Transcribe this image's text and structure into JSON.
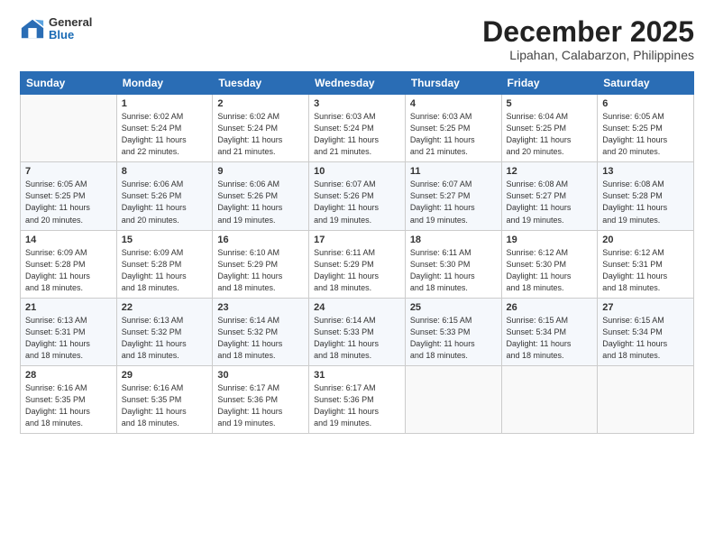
{
  "header": {
    "logo": {
      "general": "General",
      "blue": "Blue"
    },
    "title": "December 2025",
    "location": "Lipahan, Calabarzon, Philippines"
  },
  "calendar": {
    "days_of_week": [
      "Sunday",
      "Monday",
      "Tuesday",
      "Wednesday",
      "Thursday",
      "Friday",
      "Saturday"
    ],
    "weeks": [
      [
        {
          "num": "",
          "info": ""
        },
        {
          "num": "1",
          "info": "Sunrise: 6:02 AM\nSunset: 5:24 PM\nDaylight: 11 hours\nand 22 minutes."
        },
        {
          "num": "2",
          "info": "Sunrise: 6:02 AM\nSunset: 5:24 PM\nDaylight: 11 hours\nand 21 minutes."
        },
        {
          "num": "3",
          "info": "Sunrise: 6:03 AM\nSunset: 5:24 PM\nDaylight: 11 hours\nand 21 minutes."
        },
        {
          "num": "4",
          "info": "Sunrise: 6:03 AM\nSunset: 5:25 PM\nDaylight: 11 hours\nand 21 minutes."
        },
        {
          "num": "5",
          "info": "Sunrise: 6:04 AM\nSunset: 5:25 PM\nDaylight: 11 hours\nand 20 minutes."
        },
        {
          "num": "6",
          "info": "Sunrise: 6:05 AM\nSunset: 5:25 PM\nDaylight: 11 hours\nand 20 minutes."
        }
      ],
      [
        {
          "num": "7",
          "info": "Sunrise: 6:05 AM\nSunset: 5:25 PM\nDaylight: 11 hours\nand 20 minutes."
        },
        {
          "num": "8",
          "info": "Sunrise: 6:06 AM\nSunset: 5:26 PM\nDaylight: 11 hours\nand 20 minutes."
        },
        {
          "num": "9",
          "info": "Sunrise: 6:06 AM\nSunset: 5:26 PM\nDaylight: 11 hours\nand 19 minutes."
        },
        {
          "num": "10",
          "info": "Sunrise: 6:07 AM\nSunset: 5:26 PM\nDaylight: 11 hours\nand 19 minutes."
        },
        {
          "num": "11",
          "info": "Sunrise: 6:07 AM\nSunset: 5:27 PM\nDaylight: 11 hours\nand 19 minutes."
        },
        {
          "num": "12",
          "info": "Sunrise: 6:08 AM\nSunset: 5:27 PM\nDaylight: 11 hours\nand 19 minutes."
        },
        {
          "num": "13",
          "info": "Sunrise: 6:08 AM\nSunset: 5:28 PM\nDaylight: 11 hours\nand 19 minutes."
        }
      ],
      [
        {
          "num": "14",
          "info": "Sunrise: 6:09 AM\nSunset: 5:28 PM\nDaylight: 11 hours\nand 18 minutes."
        },
        {
          "num": "15",
          "info": "Sunrise: 6:09 AM\nSunset: 5:28 PM\nDaylight: 11 hours\nand 18 minutes."
        },
        {
          "num": "16",
          "info": "Sunrise: 6:10 AM\nSunset: 5:29 PM\nDaylight: 11 hours\nand 18 minutes."
        },
        {
          "num": "17",
          "info": "Sunrise: 6:11 AM\nSunset: 5:29 PM\nDaylight: 11 hours\nand 18 minutes."
        },
        {
          "num": "18",
          "info": "Sunrise: 6:11 AM\nSunset: 5:30 PM\nDaylight: 11 hours\nand 18 minutes."
        },
        {
          "num": "19",
          "info": "Sunrise: 6:12 AM\nSunset: 5:30 PM\nDaylight: 11 hours\nand 18 minutes."
        },
        {
          "num": "20",
          "info": "Sunrise: 6:12 AM\nSunset: 5:31 PM\nDaylight: 11 hours\nand 18 minutes."
        }
      ],
      [
        {
          "num": "21",
          "info": "Sunrise: 6:13 AM\nSunset: 5:31 PM\nDaylight: 11 hours\nand 18 minutes."
        },
        {
          "num": "22",
          "info": "Sunrise: 6:13 AM\nSunset: 5:32 PM\nDaylight: 11 hours\nand 18 minutes."
        },
        {
          "num": "23",
          "info": "Sunrise: 6:14 AM\nSunset: 5:32 PM\nDaylight: 11 hours\nand 18 minutes."
        },
        {
          "num": "24",
          "info": "Sunrise: 6:14 AM\nSunset: 5:33 PM\nDaylight: 11 hours\nand 18 minutes."
        },
        {
          "num": "25",
          "info": "Sunrise: 6:15 AM\nSunset: 5:33 PM\nDaylight: 11 hours\nand 18 minutes."
        },
        {
          "num": "26",
          "info": "Sunrise: 6:15 AM\nSunset: 5:34 PM\nDaylight: 11 hours\nand 18 minutes."
        },
        {
          "num": "27",
          "info": "Sunrise: 6:15 AM\nSunset: 5:34 PM\nDaylight: 11 hours\nand 18 minutes."
        }
      ],
      [
        {
          "num": "28",
          "info": "Sunrise: 6:16 AM\nSunset: 5:35 PM\nDaylight: 11 hours\nand 18 minutes."
        },
        {
          "num": "29",
          "info": "Sunrise: 6:16 AM\nSunset: 5:35 PM\nDaylight: 11 hours\nand 18 minutes."
        },
        {
          "num": "30",
          "info": "Sunrise: 6:17 AM\nSunset: 5:36 PM\nDaylight: 11 hours\nand 19 minutes."
        },
        {
          "num": "31",
          "info": "Sunrise: 6:17 AM\nSunset: 5:36 PM\nDaylight: 11 hours\nand 19 minutes."
        },
        {
          "num": "",
          "info": ""
        },
        {
          "num": "",
          "info": ""
        },
        {
          "num": "",
          "info": ""
        }
      ]
    ]
  }
}
